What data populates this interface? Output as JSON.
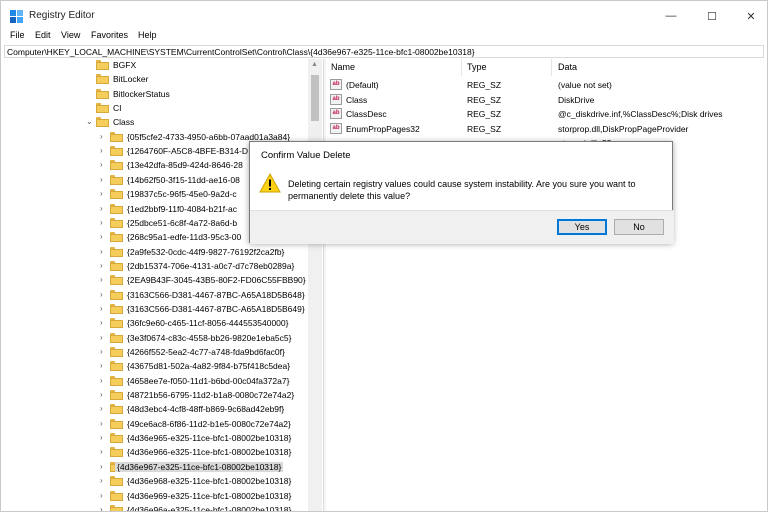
{
  "window": {
    "title": "Registry Editor",
    "controls": {
      "minimize": "—",
      "maximize": "☐",
      "close": "✕"
    }
  },
  "menu": [
    "File",
    "Edit",
    "View",
    "Favorites",
    "Help"
  ],
  "address": "Computer\\HKEY_LOCAL_MACHINE\\SYSTEM\\CurrentControlSet\\Control\\Class\\{4d36e967-e325-11ce-bfc1-08002be10318}",
  "tree": {
    "items": [
      {
        "label": "BGFX",
        "depth": 0,
        "expander": "none"
      },
      {
        "label": "BitLocker",
        "depth": 0,
        "expander": "none"
      },
      {
        "label": "BitlockerStatus",
        "depth": 0,
        "expander": "none"
      },
      {
        "label": "CI",
        "depth": 0,
        "expander": "none"
      },
      {
        "label": "Class",
        "depth": 0,
        "expander": "expanded"
      },
      {
        "label": "{05f5cfe2-4733-4950-a6bb-07aad01a3a84}",
        "depth": 1,
        "expander": "collapsed"
      },
      {
        "label": "{1264760F-A5C8-4BFE-B314-D",
        "depth": 1,
        "expander": "collapsed"
      },
      {
        "label": "{13e42dfa-85d9-424d-8646-28",
        "depth": 1,
        "expander": "collapsed"
      },
      {
        "label": "{14b62f50-3f15-11dd-ae16-08",
        "depth": 1,
        "expander": "collapsed"
      },
      {
        "label": "{19837c5c-96f5-45e0-9a2d-c",
        "depth": 1,
        "expander": "collapsed"
      },
      {
        "label": "{1ed2bbf9-11f0-4084-b21f-ac",
        "depth": 1,
        "expander": "collapsed"
      },
      {
        "label": "{25dbce51-6c8f-4a72-8a6d-b",
        "depth": 1,
        "expander": "collapsed"
      },
      {
        "label": "{268c95a1-edfe-11d3-95c3-00",
        "depth": 1,
        "expander": "collapsed"
      },
      {
        "label": "{2a9fe532-0cdc-44f9-9827-76192f2ca2fb}",
        "depth": 1,
        "expander": "collapsed"
      },
      {
        "label": "{2db15374-706e-4131-a0c7-d7c78eb0289a}",
        "depth": 1,
        "expander": "collapsed"
      },
      {
        "label": "{2EA9B43F-3045-43B5-80F2-FD06C55FBB90}",
        "depth": 1,
        "expander": "collapsed"
      },
      {
        "label": "{3163C566-D381-4467-87BC-A65A18D5B648}",
        "depth": 1,
        "expander": "collapsed"
      },
      {
        "label": "{3163C566-D381-4467-87BC-A65A18D5B649}",
        "depth": 1,
        "expander": "collapsed"
      },
      {
        "label": "{36fc9e60-c465-11cf-8056-444553540000}",
        "depth": 1,
        "expander": "collapsed"
      },
      {
        "label": "{3e3f0674-c83c-4558-bb26-9820e1eba5c5}",
        "depth": 1,
        "expander": "collapsed"
      },
      {
        "label": "{4266f552-5ea2-4c77-a748-fda9bd6fac0f}",
        "depth": 1,
        "expander": "collapsed"
      },
      {
        "label": "{43675d81-502a-4a82-9f84-b75f418c5dea}",
        "depth": 1,
        "expander": "collapsed"
      },
      {
        "label": "{4658ee7e-f050-11d1-b6bd-00c04fa372a7}",
        "depth": 1,
        "expander": "collapsed"
      },
      {
        "label": "{48721b56-6795-11d2-b1a8-0080c72e74a2}",
        "depth": 1,
        "expander": "collapsed"
      },
      {
        "label": "{48d3ebc4-4cf8-48ff-b869-9c68ad42eb9f}",
        "depth": 1,
        "expander": "collapsed"
      },
      {
        "label": "{49ce6ac8-6f86-11d2-b1e5-0080c72e74a2}",
        "depth": 1,
        "expander": "collapsed"
      },
      {
        "label": "{4d36e965-e325-11ce-bfc1-08002be10318}",
        "depth": 1,
        "expander": "collapsed"
      },
      {
        "label": "{4d36e966-e325-11ce-bfc1-08002be10318}",
        "depth": 1,
        "expander": "collapsed"
      },
      {
        "label": "{4d36e967-e325-11ce-bfc1-08002be10318}",
        "depth": 1,
        "expander": "collapsed",
        "selected": true
      },
      {
        "label": "{4d36e968-e325-11ce-bfc1-08002be10318}",
        "depth": 1,
        "expander": "collapsed"
      },
      {
        "label": "{4d36e969-e325-11ce-bfc1-08002be10318}",
        "depth": 1,
        "expander": "collapsed"
      },
      {
        "label": "{4d36e96a-e325-11ce-bfc1-08002be10318}",
        "depth": 1,
        "expander": "collapsed"
      }
    ]
  },
  "values": {
    "headers": {
      "name": "Name",
      "type": "Type",
      "data": "Data"
    },
    "rows": [
      {
        "name": "(Default)",
        "type": "REG_SZ",
        "data": "(value not set)"
      },
      {
        "name": "Class",
        "type": "REG_SZ",
        "data": "DiskDrive"
      },
      {
        "name": "ClassDesc",
        "type": "REG_SZ",
        "data": "@c_diskdrive.inf,%ClassDesc%;Disk drives"
      },
      {
        "name": "EnumPropPages32",
        "type": "REG_SZ",
        "data": "storprop.dll,DiskPropPageProvider"
      },
      {
        "name": "",
        "type": "",
        "data": "etupapi.dll,-53"
      }
    ],
    "icon_text": "ab"
  },
  "dialog": {
    "title": "Confirm Value Delete",
    "message": "Deleting certain registry values could cause system instability. Are you sure you want to permanently delete this value?",
    "yes": "Yes",
    "no": "No"
  },
  "colors": {
    "folder": "#f5cd5b",
    "selection": "#d9d9d9",
    "accent": "#0078d7"
  }
}
